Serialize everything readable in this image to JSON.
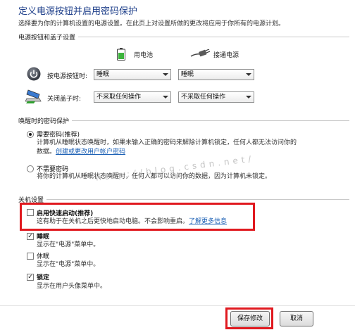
{
  "page": {
    "title": "定义电源按钮并启用密码保护",
    "subtitle": "选择要为你的计算机设置的电源设置。在此页上对设置所做的更改将应用于你所有的电源计划。"
  },
  "power_buttons": {
    "section_label": "电源按钮和盖子设置",
    "battery_label": "用电池",
    "plugged_label": "接通电源",
    "power_button_label": "按电源按钮时:",
    "power_button_battery_value": "睡眠",
    "power_button_plugged_value": "睡眠",
    "lid_label": "关闭盖子时:",
    "lid_battery_value": "不采取任何操作",
    "lid_plugged_value": "不采取任何操作"
  },
  "wake_password": {
    "section_label": "唤醒时的密码保护",
    "require_title": "需要密码(推荐)",
    "require_desc_line1": "计算机从睡眠状态唤醒时，如果未输入正确的密码来解除计算机锁定，任何人都无法访问你的",
    "require_desc_line2": "数据。",
    "require_link": "创建或更改用户帐户密码",
    "require_selected": true,
    "no_require_title": "不需要密码",
    "no_require_desc": "将你的计算机从睡眠状态唤醒时，任何人都可以访问你的数据，因为计算机未锁定。",
    "no_require_selected": false
  },
  "watermark": "http://blog.csdn.net/",
  "shutdown": {
    "section_label": "关机设置",
    "items": [
      {
        "title": "启用快速启动(推荐)",
        "desc": "这有助于在关机之后更快地启动电脑。不会影响重启。",
        "link": "了解更多信息",
        "checked": false,
        "bold": true
      },
      {
        "title": "睡眠",
        "desc": "显示在\"电源\"菜单中。",
        "checked": true,
        "bold": true
      },
      {
        "title": "休眠",
        "desc": "显示在\"电源\"菜单中。",
        "checked": false,
        "bold": false
      },
      {
        "title": "锁定",
        "desc": "显示在用户头像菜单中。",
        "checked": true,
        "bold": true
      }
    ]
  },
  "buttons": {
    "save": "保存修改",
    "cancel": "取消"
  },
  "colors": {
    "title": "#1e3f8a",
    "link": "#1a5fb4",
    "highlight": "#e0191f"
  }
}
